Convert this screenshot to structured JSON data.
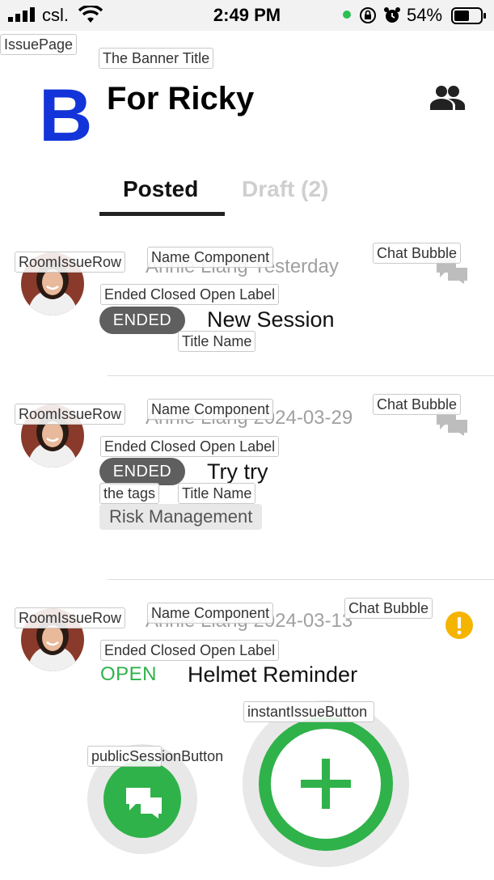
{
  "status_bar": {
    "carrier": "csl.",
    "time": "2:49 PM",
    "battery_percent": "54%"
  },
  "debug": {
    "page": "IssuePage",
    "banner_title": "The Banner Title",
    "row": "RoomIssueRow",
    "name_component": "Name Component",
    "chat_bubble": "Chat Bubble",
    "status_label": "Ended Closed Open Label",
    "title_name": "Title Name",
    "tags": "the tags",
    "instant_button": "instantIssueButton",
    "public_button": "publicSessionButton"
  },
  "header": {
    "logo_letter": "B",
    "title": "For Ricky"
  },
  "tabs": [
    {
      "label": "Posted",
      "active": true
    },
    {
      "label": "Draft (2)",
      "active": false
    }
  ],
  "issues": [
    {
      "name_date": "Annie Liang   Yesterday",
      "status": "ENDED",
      "title": "New Session"
    },
    {
      "name_date": "Annie Liang   2024-03-29",
      "status": "ENDED",
      "title": "Try try",
      "tags": [
        "Risk Management"
      ]
    },
    {
      "name_date": "Annie Liang   2024-03-13",
      "status": "OPEN",
      "title": "Helmet Reminder"
    }
  ],
  "colors": {
    "logo": "#1334d8",
    "accent_green": "#2fb24a",
    "ended_pill": "#5f5f5f",
    "warning": "#f5b400"
  }
}
